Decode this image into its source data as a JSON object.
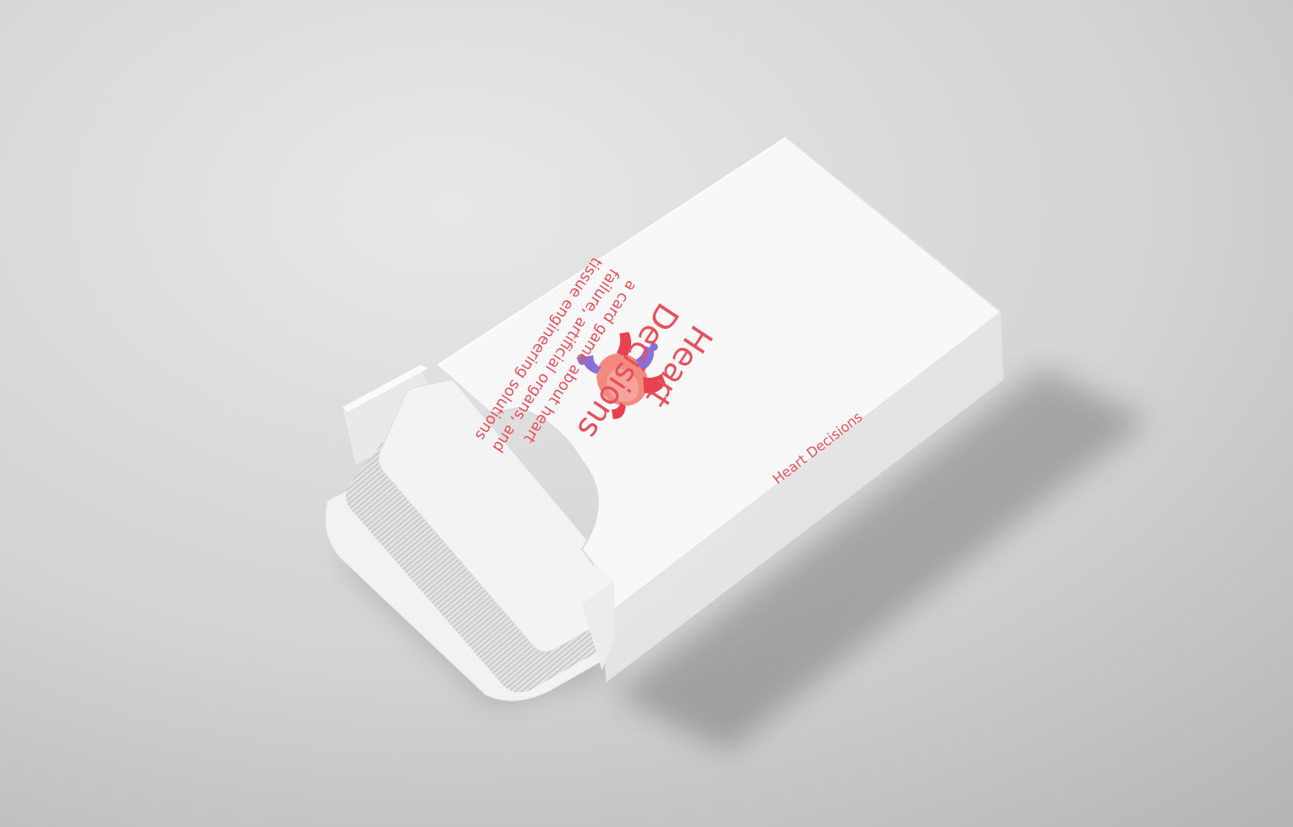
{
  "product": {
    "title_line1": "Heart",
    "title_line2": "Decisions",
    "subtitle_line1": "a card game about heart",
    "subtitle_line2": "failure, artificial organs, and",
    "subtitle_line3": "tissue engineering solutions",
    "side_label": "Heart Decisions",
    "logo_icon": "heart-organ-icon"
  },
  "colors": {
    "background_light": "#e6e6e6",
    "background_dark": "#bdbdbd",
    "box_white": "#f7f7f7",
    "box_side": "#e4e4e4",
    "text_red": "#e8505b",
    "heart_pink": "#f28a80",
    "heart_red": "#e8414f",
    "heart_purple": "#8a6fd6"
  }
}
